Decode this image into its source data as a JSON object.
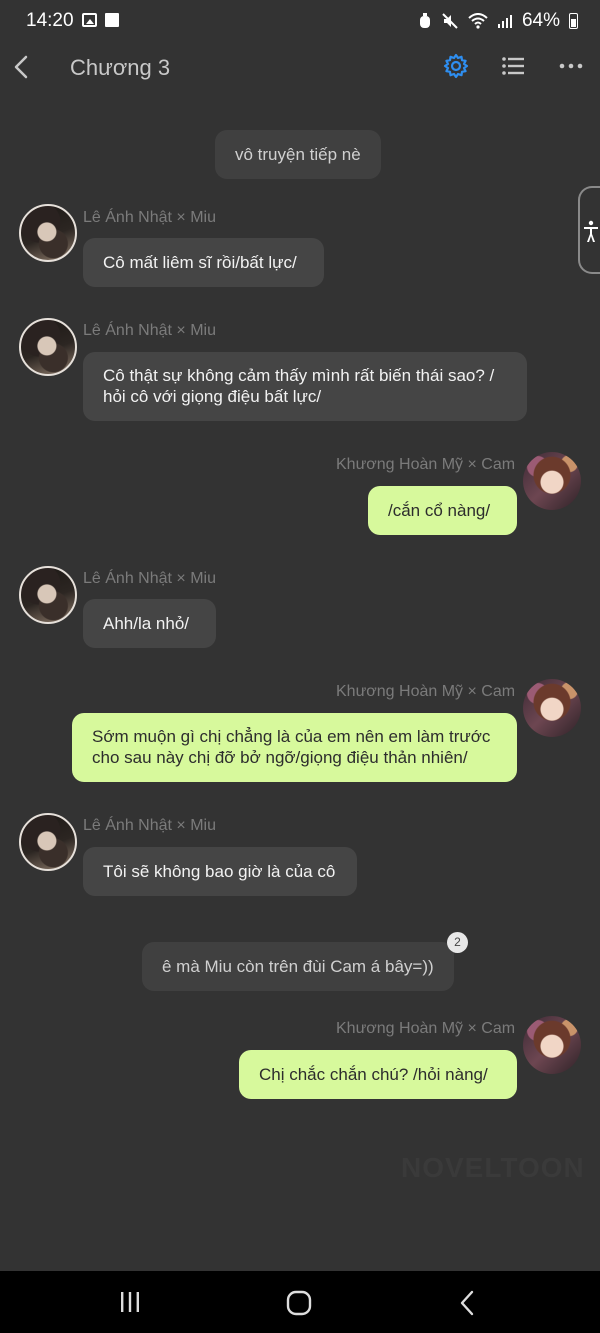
{
  "status_bar": {
    "time": "14:20",
    "battery": "64%"
  },
  "header": {
    "title": "Chương 3",
    "accent_color": "#2e8ef0"
  },
  "messages": {
    "system_1": "vô truyện tiếp nè",
    "system_2": "ê mà Miu còn trên đùi Cam á bây=))",
    "system_2_badge": "2",
    "miu_name": "Lê Ánh Nhật × Miu",
    "cam_name": "Khương Hoàn Mỹ × Cam",
    "m1": "Cô mất liêm sĩ rồi/bất lực/",
    "m2_line1": "Cô thật sự không cảm thấy mình rất biến thái sao? /",
    "m2_line2": "hỏi cô với giọng điệu bất lực/",
    "c1": "/cắn cổ nàng/",
    "m3": "Ahh/la nhỏ/",
    "c2_line1": "Sớm muộn gì chị chẳng là của em nên em làm trước",
    "c2_line2": "cho sau này chị đỡ bở ngỡ/giọng điệu thản nhiên/",
    "m4": "Tôi sẽ không bao giờ là của cô",
    "c3": "Chị chắc chắn chú? /hỏi nàng/"
  },
  "watermark": "NOVELTOON",
  "colors": {
    "background": "#333333",
    "bubble_left": "#454545",
    "bubble_right": "#d7f99c"
  },
  "icons": [
    "back-arrow-icon",
    "gear-icon",
    "list-icon",
    "more-icon",
    "accessibility-icon",
    "recents-icon",
    "home-icon",
    "nav-back-icon"
  ]
}
